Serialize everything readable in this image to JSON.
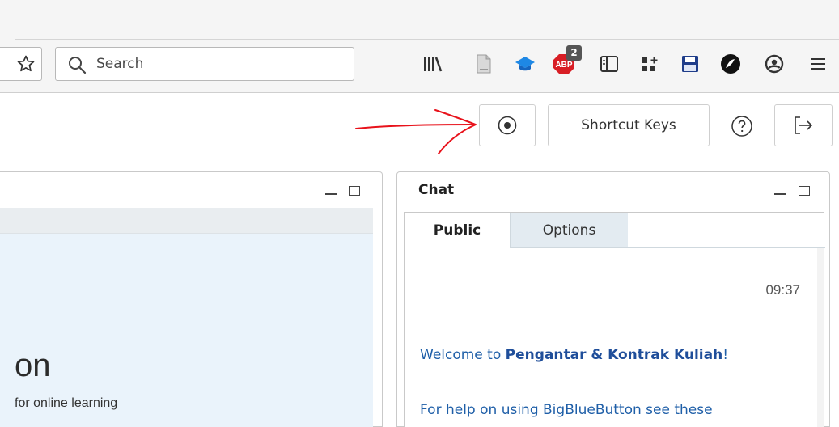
{
  "browser": {
    "search": {
      "placeholder": "Search"
    },
    "addon_badge": "2",
    "toolbar_icons": [
      "star-icon",
      "library-icon",
      "reader-view-icon",
      "graduation-cap-icon",
      "adblock-icon",
      "sidebar-icon",
      "extensions-icon",
      "save-icon",
      "stylish-icon",
      "account-icon",
      "menu-icon"
    ]
  },
  "header": {
    "record_icon": "record-icon",
    "shortcut_keys_label": "Shortcut Keys",
    "help_icon": "help-icon",
    "logout_icon": "logout-icon"
  },
  "presentation": {
    "title_fragment": "on",
    "subtitle_fragment": "for online learning"
  },
  "chat": {
    "title": "Chat",
    "tabs": [
      {
        "label": "Public",
        "active": true
      },
      {
        "label": "Options",
        "active": false
      }
    ],
    "message": {
      "time": "09:37",
      "welcome_prefix": "Welcome to ",
      "welcome_room": "Pengantar & Kontrak Kuliah",
      "welcome_suffix": "!",
      "help_text": "For help on using BigBlueButton see these"
    }
  },
  "colors": {
    "annotation_arrow": "#e8121b",
    "chat_link": "#1f5fa8",
    "options_tab_bg": "#e3ebf1",
    "presentation_bg": "#eaf3fb"
  }
}
